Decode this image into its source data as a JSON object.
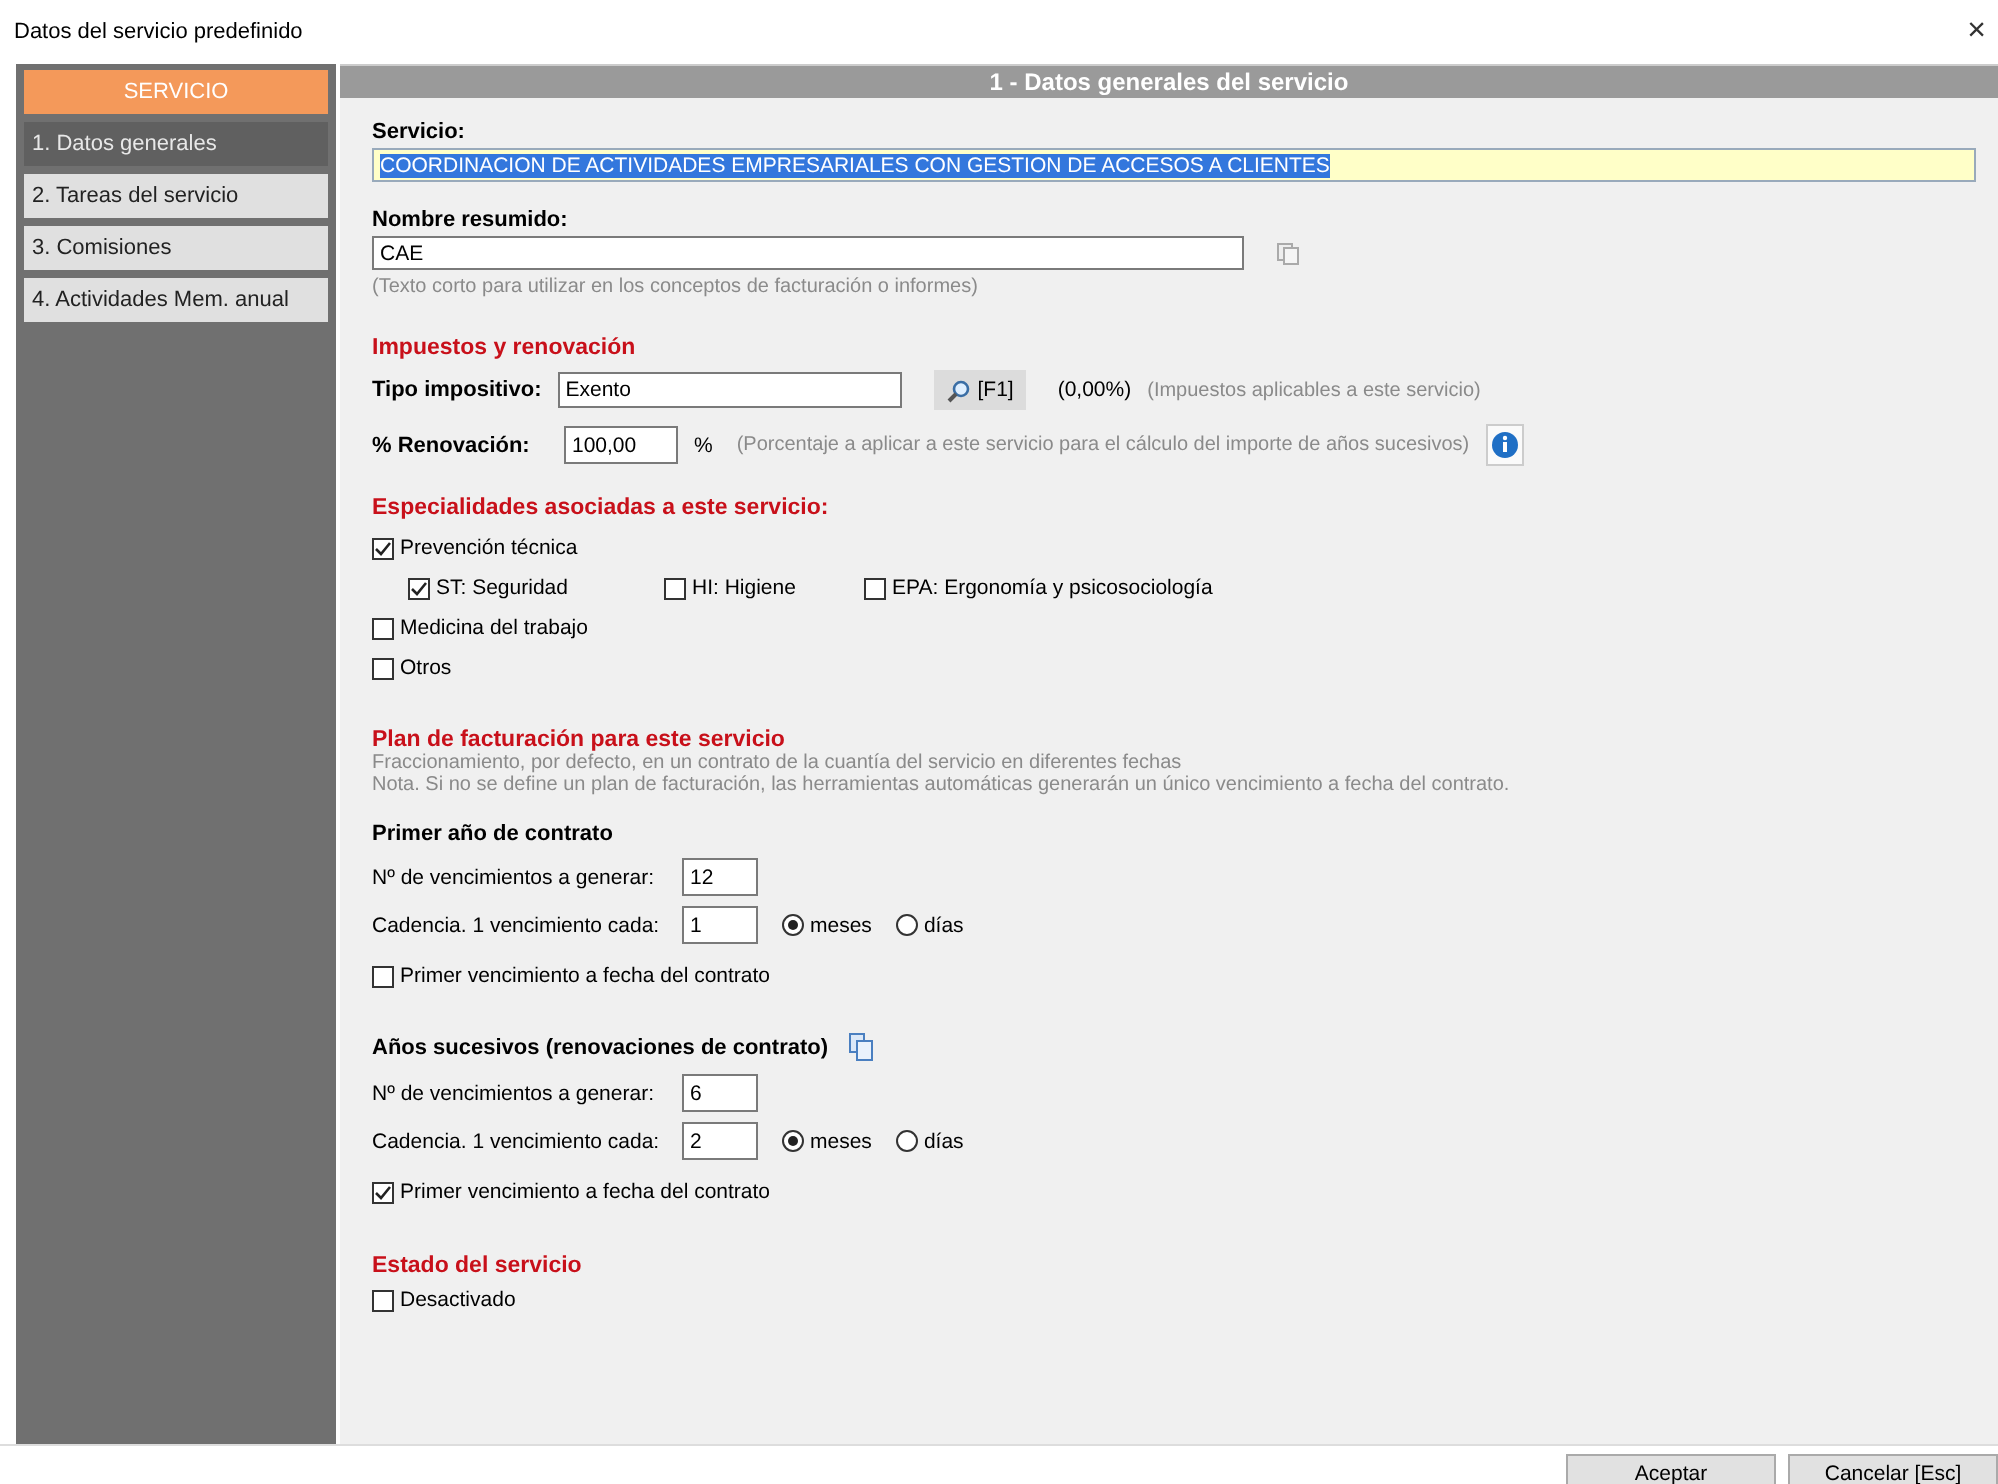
{
  "window": {
    "title": "Datos del servicio predefinido",
    "close": "×"
  },
  "sidebar": {
    "header": "SERVICIO",
    "items": [
      {
        "label": "1. Datos generales",
        "selected": true
      },
      {
        "label": "2. Tareas del servicio",
        "selected": false
      },
      {
        "label": "3. Comisiones",
        "selected": false
      },
      {
        "label": "4. Actividades Mem. anual",
        "selected": false
      }
    ]
  },
  "content": {
    "header": "1 - Datos generales del servicio",
    "servicio": {
      "label": "Servicio:",
      "value": "COORDINACION DE ACTIVIDADES EMPRESARIALES CON GESTION DE ACCESOS A CLIENTES"
    },
    "nombre": {
      "label": "Nombre resumido:",
      "value": "CAE",
      "hint": "(Texto corto para utilizar en los conceptos de facturación o informes)"
    },
    "impuestos": {
      "title": "Impuestos y renovación",
      "tipo": {
        "label": "Tipo impositivo:",
        "value": "Exento",
        "lookup_button": "[F1]",
        "rate": "(0,00%)",
        "hint": "(Impuestos aplicables a este servicio)"
      },
      "renovacion": {
        "label": "% Renovación:",
        "value": "100,00",
        "unit": "%",
        "hint": "(Porcentaje a aplicar a este servicio para el cálculo del importe de años sucesivos)"
      }
    },
    "especialidades": {
      "title": "Especialidades asociadas a este servicio:",
      "items": [
        {
          "label": "Prevención técnica",
          "checked": true,
          "children": [
            {
              "label": "ST: Seguridad",
              "checked": true
            },
            {
              "label": "HI: Higiene",
              "checked": false
            },
            {
              "label": "EPA: Ergonomía y psicosociología",
              "checked": false
            }
          ]
        },
        {
          "label": "Medicina del trabajo",
          "checked": false
        },
        {
          "label": "Otros",
          "checked": false
        }
      ]
    },
    "plan": {
      "title": "Plan de facturación para este servicio",
      "notes": [
        "Fraccionamiento, por defecto, en un contrato de la cuantía del servicio en diferentes fechas",
        "Nota. Si no se define un plan de facturación,  las herramientas automáticas generarán un único vencimiento a fecha del contrato."
      ],
      "sections": [
        {
          "title": "Primer año de contrato",
          "copy_icon": false,
          "count_label": "Nº de vencimientos a generar:",
          "count": "12",
          "cadence_label": "Cadencia. 1 vencimiento cada:",
          "cadence": "1",
          "units": [
            {
              "label": "meses",
              "selected": true
            },
            {
              "label": "días",
              "selected": false
            }
          ],
          "first_at_contract": {
            "label": "Primer vencimiento a fecha del contrato",
            "checked": false
          }
        },
        {
          "title": "Años sucesivos (renovaciones de contrato)",
          "copy_icon": true,
          "count_label": "Nº de vencimientos a generar:",
          "count": "6",
          "cadence_label": "Cadencia. 1 vencimiento cada:",
          "cadence": "2",
          "units": [
            {
              "label": "meses",
              "selected": true
            },
            {
              "label": "días",
              "selected": false
            }
          ],
          "first_at_contract": {
            "label": "Primer vencimiento a fecha del contrato",
            "checked": true
          }
        }
      ]
    },
    "estado": {
      "title": "Estado del servicio",
      "desactivado": {
        "label": "Desactivado",
        "checked": false
      }
    }
  },
  "buttons": [
    "Aceptar",
    "Cancelar [Esc]"
  ]
}
